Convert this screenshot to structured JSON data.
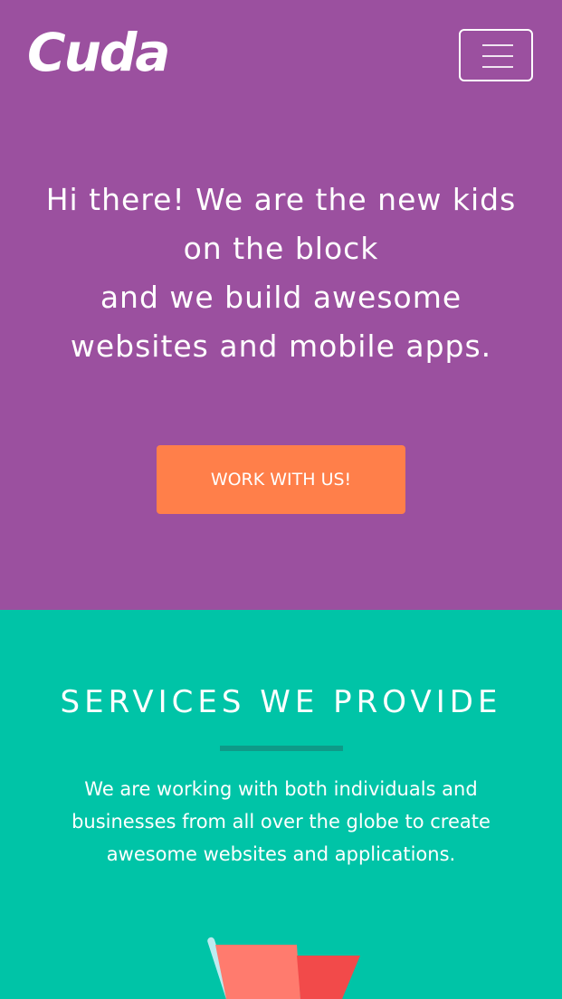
{
  "header": {
    "logo_text": "Cuda",
    "menu_icon": "hamburger-menu-icon"
  },
  "hero": {
    "headline_lines": [
      "Hi there! We are the new kids",
      "on the block",
      "and we build awesome",
      "websites and mobile apps."
    ],
    "cta_label": "WORK WITH US!"
  },
  "services": {
    "title": "SERVICES WE PROVIDE",
    "description_lines": [
      "We are working with both individuals and",
      "businesses from all over the globe to create",
      "awesome websites and applications."
    ]
  },
  "colors": {
    "hero_background": "#9b509f",
    "services_background": "#00c4a7",
    "cta_background": "#ff7f4a",
    "divider": "#0e9a88"
  }
}
